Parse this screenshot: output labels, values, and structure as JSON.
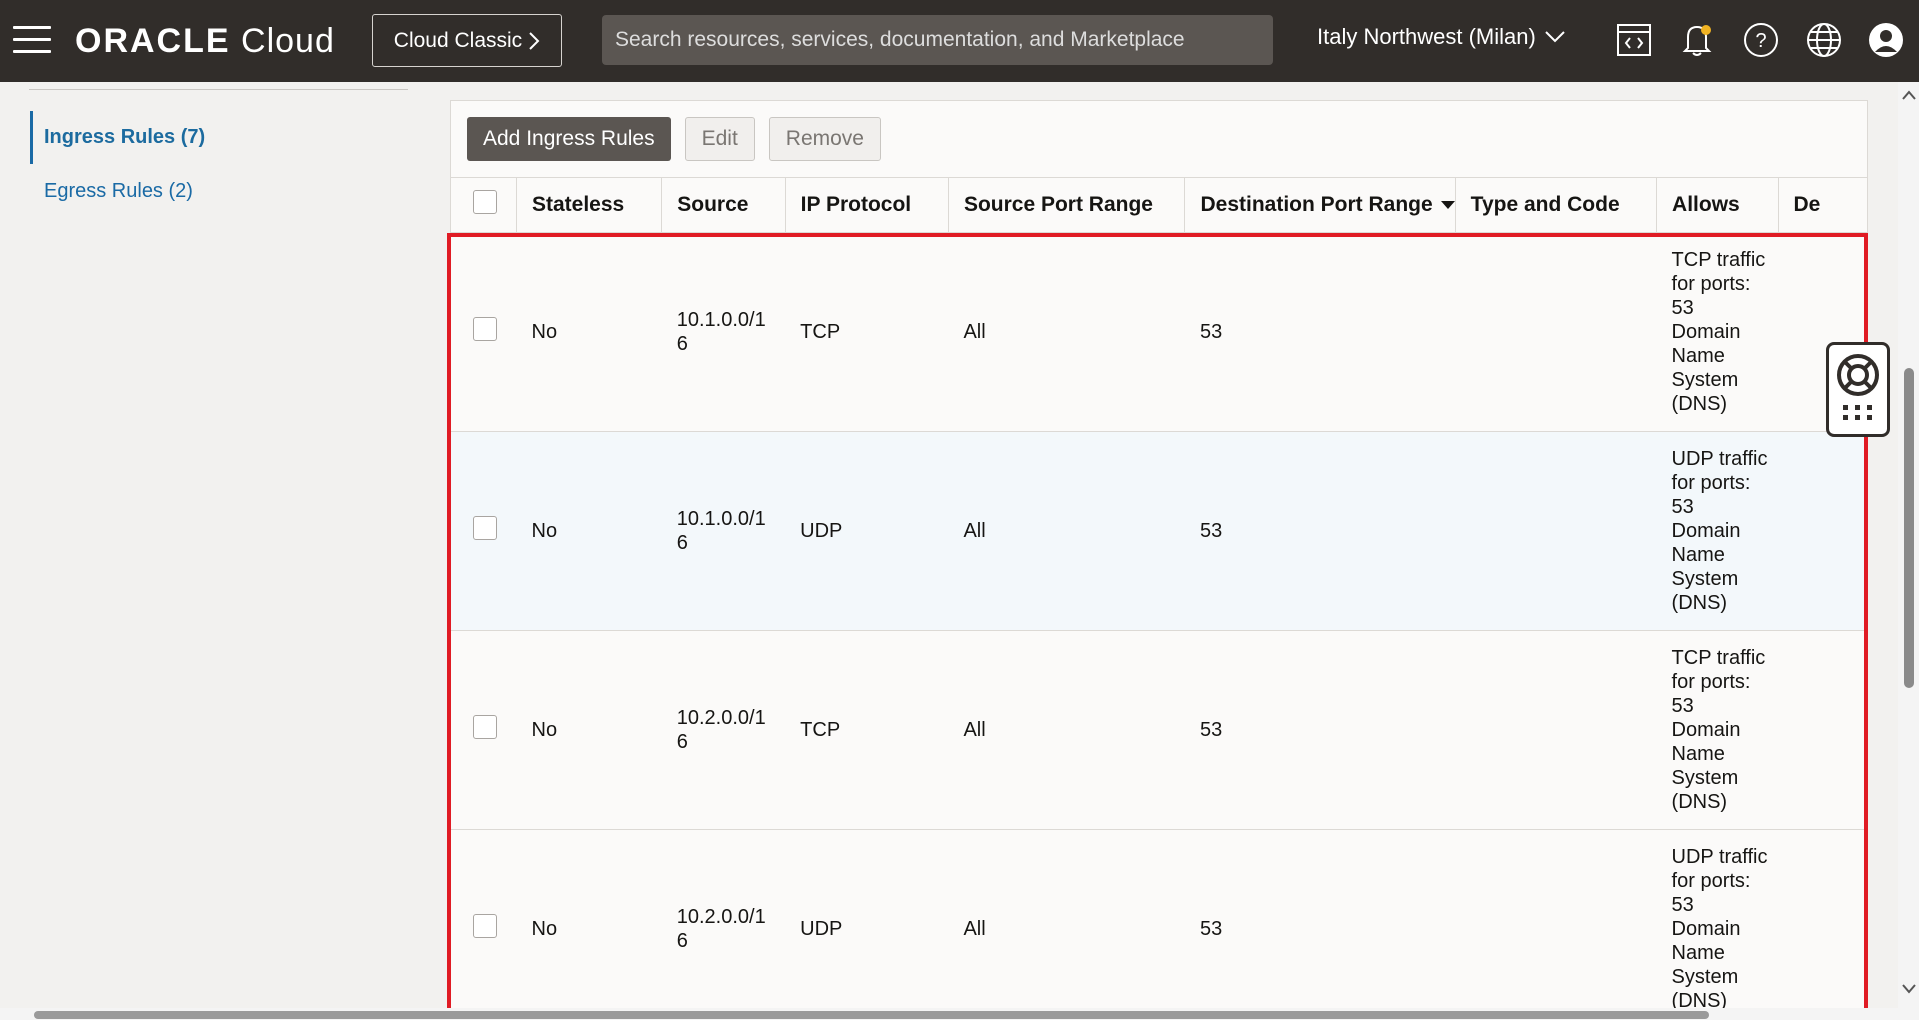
{
  "header": {
    "brand_bold": "ORACLE",
    "brand_light": "Cloud",
    "classic_button": "Cloud Classic",
    "search_placeholder": "Search resources, services, documentation, and Marketplace",
    "region": "Italy Northwest (Milan)",
    "icons": [
      "menu-icon",
      "code-editor-icon",
      "bell-icon",
      "help-icon",
      "globe-icon",
      "profile-icon"
    ]
  },
  "sidebar": {
    "items": [
      {
        "label": "Ingress Rules (7)",
        "active": true
      },
      {
        "label": "Egress Rules (2)",
        "active": false
      }
    ]
  },
  "toolbar": {
    "add_label": "Add Ingress Rules",
    "edit_label": "Edit",
    "remove_label": "Remove"
  },
  "table": {
    "columns": [
      "Stateless",
      "Source",
      "IP Protocol",
      "Source Port Range",
      "Destination Port Range",
      "Type and Code",
      "Allows",
      "De"
    ],
    "sorted_column": "Destination Port Range",
    "rows": [
      {
        "stateless": "No",
        "source": "10.1.0.0/16",
        "protocol": "TCP",
        "source_port": "All",
        "dest_port": "53",
        "type_code": "",
        "allows": "TCP traffic for ports: 53 Domain Name System (DNS)"
      },
      {
        "stateless": "No",
        "source": "10.1.0.0/16",
        "protocol": "UDP",
        "source_port": "All",
        "dest_port": "53",
        "type_code": "",
        "allows": "UDP traffic for ports: 53 Domain Name System (DNS)"
      },
      {
        "stateless": "No",
        "source": "10.2.0.0/16",
        "protocol": "TCP",
        "source_port": "All",
        "dest_port": "53",
        "type_code": "",
        "allows": "TCP traffic for ports: 53 Domain Name System (DNS)"
      },
      {
        "stateless": "No",
        "source": "10.2.0.0/16",
        "protocol": "UDP",
        "source_port": "All",
        "dest_port": "53",
        "type_code": "",
        "allows": "UDP traffic for ports: 53 Domain Name System (DNS)"
      }
    ]
  },
  "colors": {
    "topbar": "#312d2a",
    "link": "#1a6aa5",
    "highlight": "#e01b24",
    "primary_button": "#5b5652"
  }
}
